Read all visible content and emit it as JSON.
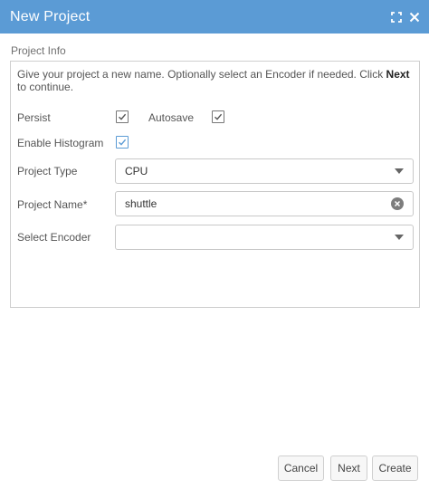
{
  "window": {
    "title": "New Project",
    "icons": [
      "fullscreen-icon",
      "close-icon"
    ]
  },
  "section": {
    "label": "Project Info"
  },
  "intro": {
    "text_before": "Give your project a new name. Optionally select an Encoder if needed. Click ",
    "bold": "Next",
    "text_after": " to continue."
  },
  "form": {
    "persist": {
      "label": "Persist",
      "checked": true
    },
    "autosave": {
      "label": "Autosave",
      "checked": true
    },
    "histogram": {
      "label": "Enable Histogram",
      "checked": true
    },
    "project_type": {
      "label": "Project Type",
      "value": "CPU"
    },
    "project_name": {
      "label": "Project Name*",
      "value": "shuttle"
    },
    "encoder": {
      "label": "Select Encoder",
      "value": ""
    }
  },
  "buttons": {
    "cancel": "Cancel",
    "next": "Next",
    "create": "Create"
  },
  "colors": {
    "titlebar": "#5b9bd5",
    "accent_checkbox": "#5b9bd5"
  }
}
